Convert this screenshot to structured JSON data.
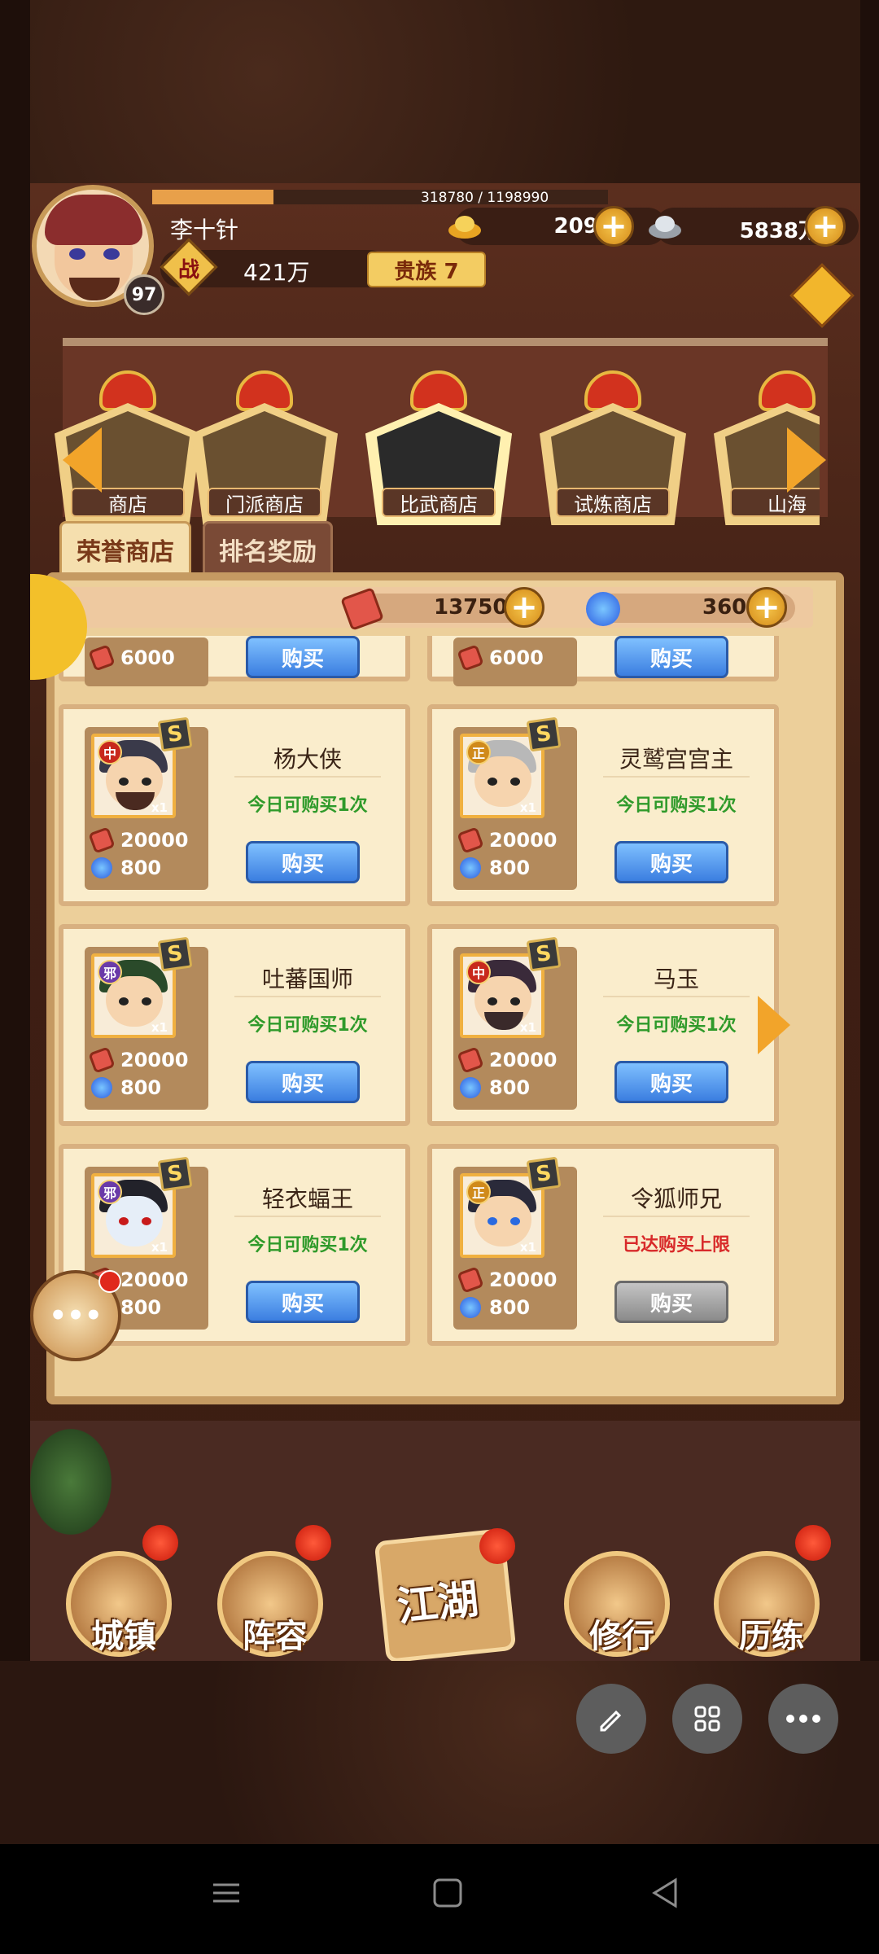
{
  "header": {
    "exp_text": "318780 / 1198990",
    "exp_ratio": 0.266,
    "player_name": "李十针",
    "level": "97",
    "gold": "20993",
    "silver": "5838万",
    "power_icon_label": "战",
    "power": "421万",
    "noble": "贵族 7"
  },
  "shops": [
    {
      "label": "商店"
    },
    {
      "label": "门派商店"
    },
    {
      "label": "比武商店",
      "active": true
    },
    {
      "label": "试炼商店"
    },
    {
      "label": "山海"
    }
  ],
  "subtabs": [
    {
      "label": "荣誉商店",
      "active": true
    },
    {
      "label": "排名奖励",
      "active": false
    }
  ],
  "resources": {
    "honor": "13750",
    "spirit": "360"
  },
  "items": [
    {
      "price_honor": "6000",
      "buy": "购买"
    },
    {
      "price_honor": "6000",
      "buy": "购买"
    },
    {
      "name": "杨大侠",
      "faction": "中",
      "qty": "x1",
      "price_honor": "20000",
      "price_spirit": "800",
      "limit": "今日可购买1次",
      "buy": "购买"
    },
    {
      "name": "灵鹫宫宫主",
      "faction": "正",
      "qty": "x1",
      "price_honor": "20000",
      "price_spirit": "800",
      "limit": "今日可购买1次",
      "buy": "购买"
    },
    {
      "name": "吐蕃国师",
      "faction": "邪",
      "qty": "x1",
      "price_honor": "20000",
      "price_spirit": "800",
      "limit": "今日可购买1次",
      "buy": "购买"
    },
    {
      "name": "马玉",
      "faction": "中",
      "qty": "x1",
      "price_honor": "20000",
      "price_spirit": "800",
      "limit": "今日可购买1次",
      "buy": "购买"
    },
    {
      "name": "轻衣蝠王",
      "faction": "邪",
      "qty": "x1",
      "price_honor": "20000",
      "price_spirit": "800",
      "limit": "今日可购买1次",
      "buy": "购买"
    },
    {
      "name": "令狐师兄",
      "faction": "正",
      "qty": "x1",
      "price_honor": "20000",
      "price_spirit": "800",
      "limit": "已达购买上限",
      "buy": "购买",
      "disabled": true
    }
  ],
  "rank_badge": "S",
  "bottom_nav": [
    {
      "label": "城镇"
    },
    {
      "label": "阵容"
    },
    {
      "label": "江湖"
    },
    {
      "label": "修行"
    },
    {
      "label": "历练"
    }
  ],
  "colors": {
    "buy_button": "#3b7ee0",
    "limit_ok": "#2f9a2a",
    "limit_maxed": "#d82a2a",
    "panel": "#eccf9a"
  },
  "icons": {
    "overlay": [
      "pencil-icon",
      "grid-icon",
      "more-icon"
    ],
    "system_nav": [
      "menu-icon",
      "home-icon",
      "back-icon"
    ]
  }
}
